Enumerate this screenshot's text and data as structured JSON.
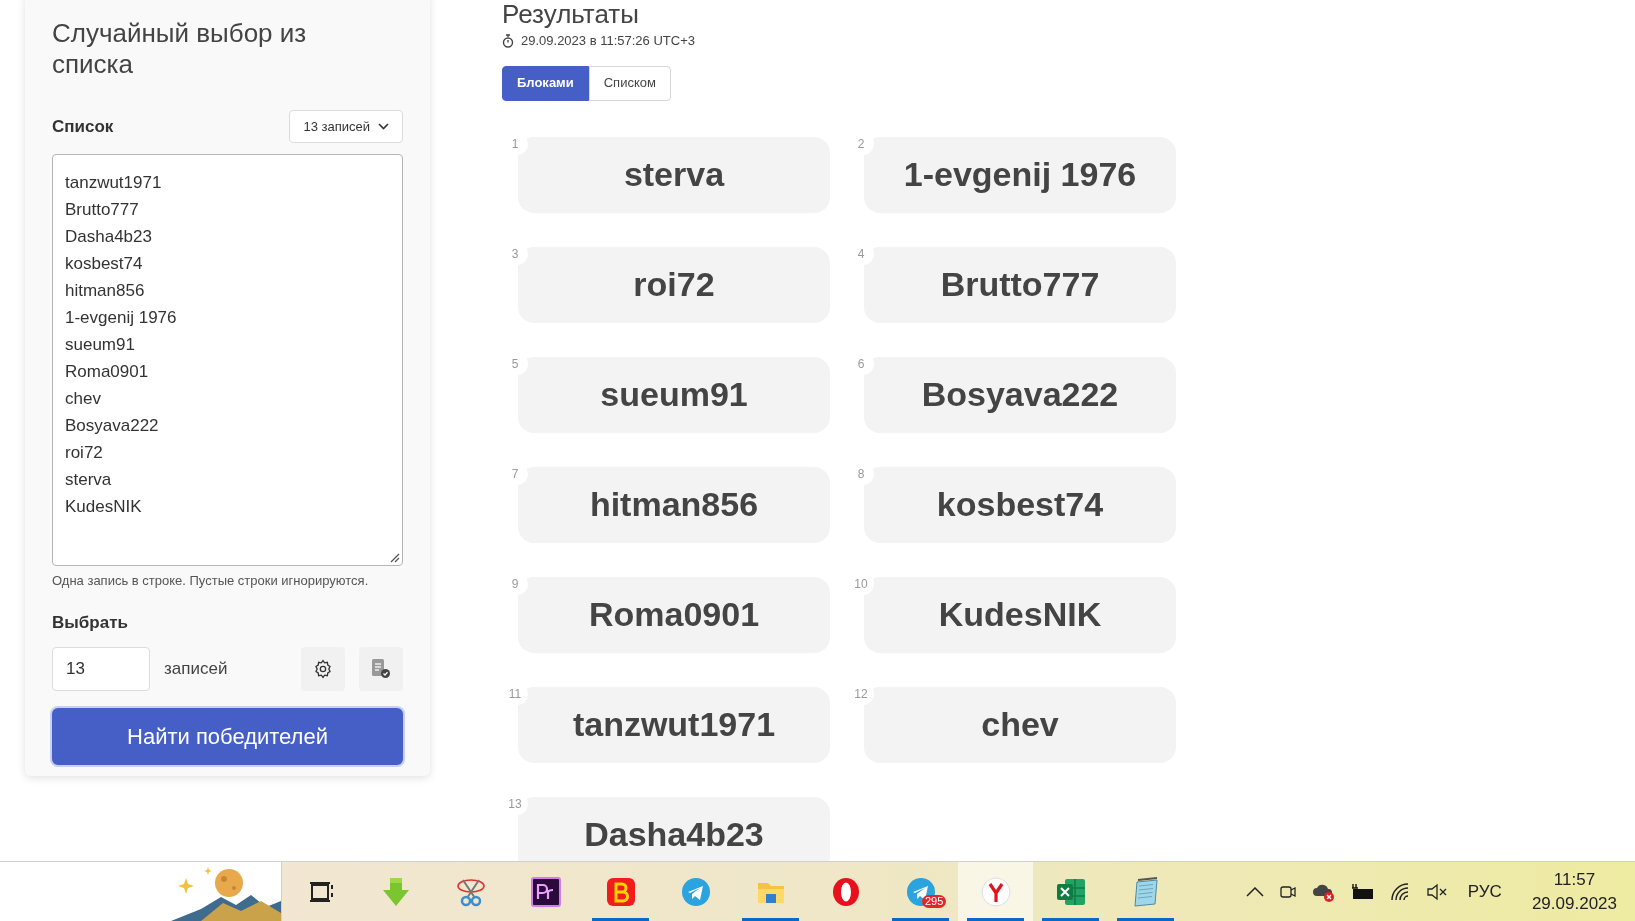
{
  "picker": {
    "title": "Случайный выбор из списка",
    "list_label": "Список",
    "count_select": "13 записей",
    "entries": [
      "tanzwut1971",
      "Brutto777",
      "Dasha4b23",
      "kosbest74",
      "hitman856",
      "1-evgenij 1976",
      "sueum91",
      "Roma0901",
      "chev",
      "Bosyava222",
      "roi72",
      "sterva",
      "KudesNIK"
    ],
    "hint": "Одна запись в строке. Пустые строки игнорируются.",
    "pick_label": "Выбрать",
    "pick_count": "13",
    "pick_unit": "записей",
    "submit": "Найти победителей"
  },
  "results": {
    "title": "Результаты",
    "timestamp": "29.09.2023 в 11:57:26 UTC+3",
    "tabs": [
      {
        "label": "Блоками",
        "selected": true
      },
      {
        "label": "Списком",
        "selected": false
      }
    ],
    "winners": [
      {
        "number": "1",
        "name": "sterva"
      },
      {
        "number": "2",
        "name": "1-evgenij 1976"
      },
      {
        "number": "3",
        "name": "roi72"
      },
      {
        "number": "4",
        "name": "Brutto777"
      },
      {
        "number": "5",
        "name": "sueum91"
      },
      {
        "number": "6",
        "name": "Bosyava222"
      },
      {
        "number": "7",
        "name": "hitman856"
      },
      {
        "number": "8",
        "name": "kosbest74"
      },
      {
        "number": "9",
        "name": "Roma0901"
      },
      {
        "number": "10",
        "name": "KudesNIK"
      },
      {
        "number": "11",
        "name": "tanzwut1971"
      },
      {
        "number": "12",
        "name": "chev"
      },
      {
        "number": "13",
        "name": "Dasha4b23"
      }
    ]
  },
  "taskbar": {
    "apps": [
      {
        "kind": "taskview",
        "running": false,
        "active": false
      },
      {
        "kind": "download",
        "running": false,
        "active": false
      },
      {
        "kind": "scissors",
        "running": false,
        "active": false
      },
      {
        "kind": "premiere",
        "running": false,
        "active": false
      },
      {
        "kind": "bbrowser",
        "running": true,
        "active": false
      },
      {
        "kind": "telegram",
        "running": false,
        "active": false
      },
      {
        "kind": "files",
        "running": true,
        "active": false
      },
      {
        "kind": "opera",
        "running": false,
        "active": false
      },
      {
        "kind": "telegram",
        "running": true,
        "active": false,
        "badge": "295"
      },
      {
        "kind": "yandex",
        "running": true,
        "active": true
      },
      {
        "kind": "excel",
        "running": true,
        "active": false
      },
      {
        "kind": "notepad",
        "running": true,
        "active": false
      }
    ],
    "language": "РУС",
    "time": "11:57",
    "date": "29.09.2023"
  }
}
